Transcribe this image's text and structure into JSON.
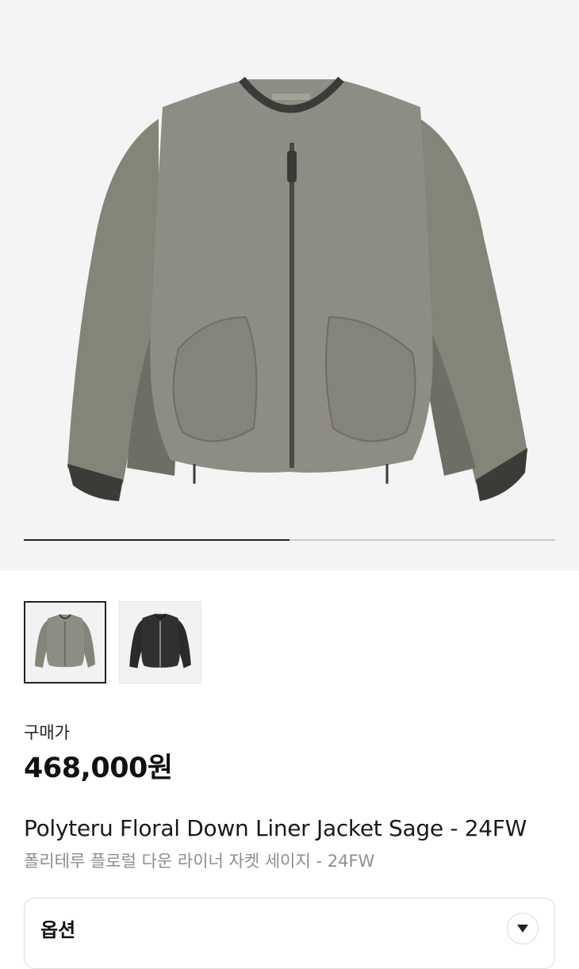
{
  "gallery": {
    "progress": 0.5,
    "thumbnails": [
      {
        "name": "thumbnail-sage-jacket",
        "selected": true,
        "color": "#8b8a82"
      },
      {
        "name": "thumbnail-black-jacket",
        "selected": false,
        "color": "#2a2a2a"
      }
    ]
  },
  "product": {
    "price_label": "구매가",
    "price": "468,000원",
    "title_en": "Polyteru Floral Down Liner Jacket Sage - 24FW",
    "title_ko": "폴리테루 플로럴 다운 라이너 자켓 세이지 - 24FW"
  },
  "option": {
    "label": "옵션",
    "icon": "chevron-down-icon"
  },
  "colors": {
    "jacket_body": "#8e8d85",
    "jacket_shadow": "#6e6d66",
    "rib_trim": "#3c3b37",
    "background": "#f4f4f4"
  }
}
